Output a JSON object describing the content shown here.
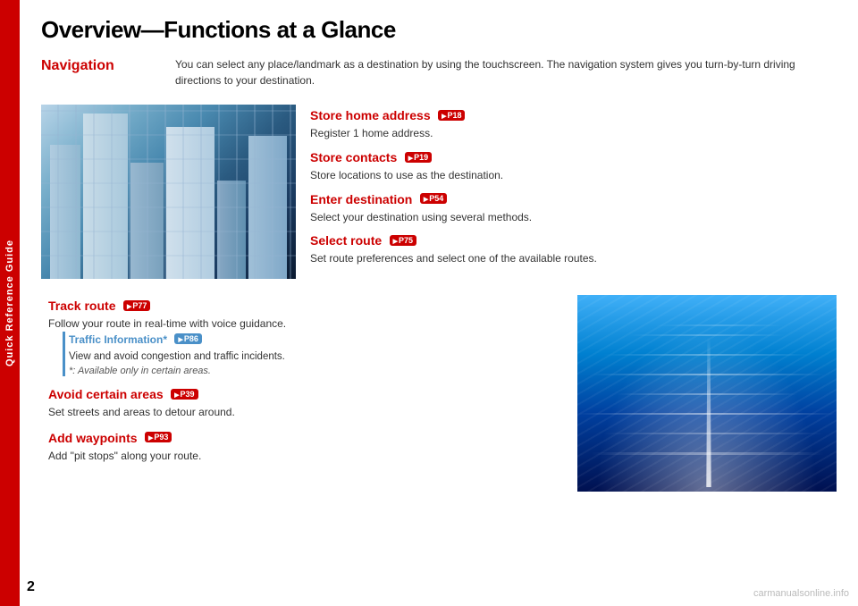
{
  "sidebar": {
    "label": "Quick Reference Guide",
    "color": "#cc0000"
  },
  "page": {
    "number": "2",
    "title": "Overview—Functions at a Glance"
  },
  "navigation_section": {
    "header": "Navigation",
    "description": "You can select any place/landmark as a destination by using the touchscreen. The navigation system gives you turn-by-turn driving directions to your destination."
  },
  "features": [
    {
      "title": "Store home address",
      "badge": "P18",
      "description": "Register 1 home address."
    },
    {
      "title": "Store contacts",
      "badge": "P19",
      "description": "Store locations to use as the destination."
    },
    {
      "title": "Enter destination",
      "badge": "P54",
      "description": "Select your destination using several methods."
    },
    {
      "title": "Select route",
      "badge": "P75",
      "description": "Set route preferences and select one of the available routes."
    }
  ],
  "bottom_features": [
    {
      "title": "Track route",
      "badge": "P77",
      "description": "Follow your route in real-time with voice guidance.",
      "sub_feature": {
        "title": "Traffic Information*",
        "badge": "P86",
        "description": "View and avoid congestion and traffic incidents.",
        "note": "*: Available only in certain areas."
      }
    },
    {
      "title": "Avoid certain areas",
      "badge": "P39",
      "description": "Set streets and areas to detour around."
    },
    {
      "title": "Add waypoints",
      "badge": "P93",
      "description": "Add \"pit stops\" along your route."
    }
  ],
  "watermark": {
    "text": "carmanualsonline.info"
  }
}
